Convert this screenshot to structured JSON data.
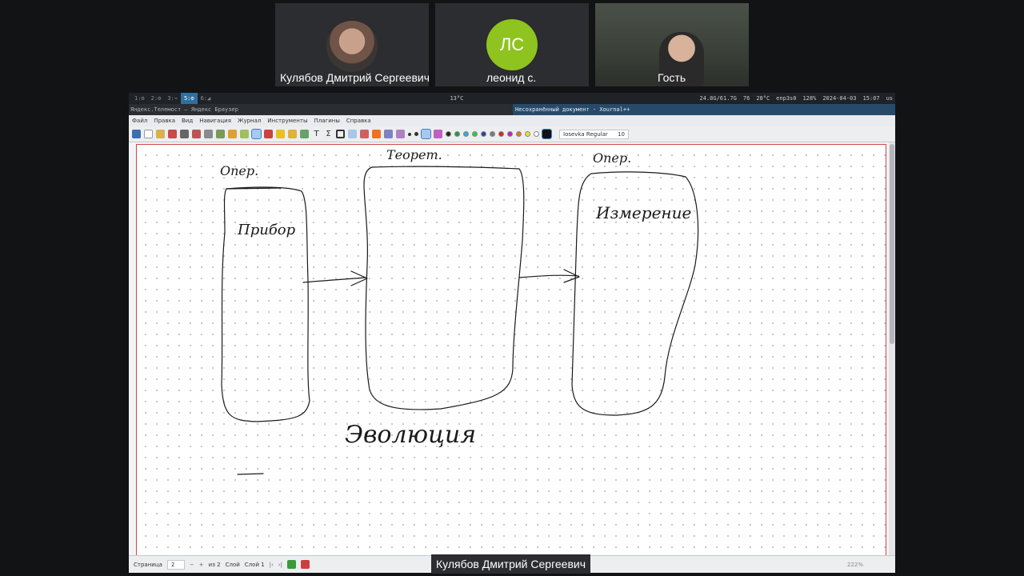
{
  "participants": [
    {
      "name": "Кулябов Дмитрий Сергеевич"
    },
    {
      "name": "леонид с.",
      "initials": "ЛС"
    },
    {
      "name": "Гость"
    }
  ],
  "sysbar": {
    "workspaces": [
      "1:⚙",
      "2:⚙",
      "3:⌁",
      "5:⚙",
      "6:◢"
    ],
    "weather": "13°C",
    "mem": "24.8G/61.7G",
    "battery": "76",
    "temp": "28°C",
    "net": "enp3s0",
    "volume": "128%",
    "date": "2024-04-03",
    "time": "15:07",
    "layout": "us"
  },
  "titlebar": {
    "browser": "Яндекс.Телемост — Яндекс Браузер",
    "app": "Несохранённый документ - Xournal++"
  },
  "menu": [
    "Файл",
    "Правка",
    "Вид",
    "Навигация",
    "Журнал",
    "Инструменты",
    "Плагины",
    "Справка"
  ],
  "toolbar": {
    "font": "Iosevka Regular",
    "font_size": "10"
  },
  "colors": [
    "#222222",
    "#1f9e3a",
    "#2bb0d6",
    "#2ecc40",
    "#3040a0",
    "#7a7a7a",
    "#e02020",
    "#c020c0",
    "#e07a1a",
    "#f0e020",
    "#ffffff"
  ],
  "drawing": {
    "labels": [
      "Опер.",
      "Теорет.",
      "Опер.",
      "Прибор",
      "Измерение",
      "Эволюция"
    ]
  },
  "status": {
    "page_label": "Страница",
    "page_value": "2",
    "page_of": "из 2",
    "layer_label": "Слой",
    "layer_value": "Слой 1",
    "zoom": "222%"
  },
  "speaker": "Кулябов Дмитрий Сергеевич"
}
